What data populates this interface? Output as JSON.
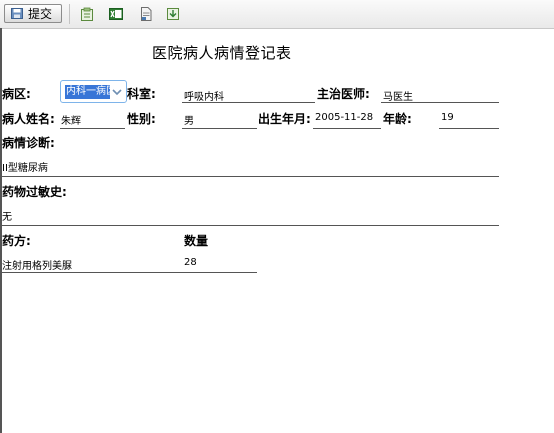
{
  "toolbar": {
    "submit_label": "提交",
    "icons": [
      "clipboard-icon",
      "excel-export-icon",
      "document-icon",
      "download-icon"
    ]
  },
  "form": {
    "title": "医院病人病情登记表",
    "ward": {
      "label": "病区:",
      "value": "内科一病区"
    },
    "department": {
      "label": "科室:",
      "value": "呼吸内科"
    },
    "doctor": {
      "label": "主治医师:",
      "value": "马医生"
    },
    "patient_name": {
      "label": "病人姓名:",
      "value": "朱辉"
    },
    "gender": {
      "label": "性别:",
      "value": "男"
    },
    "birth_date": {
      "label": "出生年月:",
      "value": "2005-11-28"
    },
    "age": {
      "label": "年龄:",
      "value": "19"
    },
    "diagnosis": {
      "label": "病情诊断:",
      "value": "II型糖尿病"
    },
    "allergy": {
      "label": "药物过敏史:",
      "value": "无"
    },
    "prescription": {
      "label": "药方:",
      "quantity_header": "数量",
      "items": [
        {
          "drug": "注射用格列美脲",
          "quantity": "28"
        }
      ]
    }
  },
  "colors": {
    "accent": "#3875d7",
    "select_border": "#7eb4ea",
    "underline": "#555555"
  }
}
